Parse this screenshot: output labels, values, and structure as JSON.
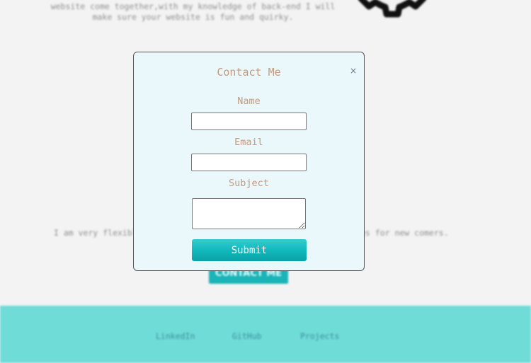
{
  "background": {
    "intro_line_1": "website come together,with my knowledge of back-end I will",
    "intro_line_2": "make sure your website is fun and quirky.",
    "flex_text_left": "I am very flexible",
    "flex_text_right": "es for new comers.",
    "contact_button_label": "CONTACT ME",
    "gear_icon": "gear-icon"
  },
  "footer": {
    "links": [
      "LinkedIn",
      "GitHub",
      "Projects"
    ],
    "background_color": "#6fdcd8",
    "link_color": "#3c8c97"
  },
  "modal": {
    "title": "Contact Me",
    "close_symbol": "×",
    "name_label": "Name",
    "name_value": "",
    "email_label": "Email",
    "email_value": "",
    "subject_label": "Subject",
    "subject_value": "",
    "submit_label": "Submit",
    "accent_color": "#19b3b8",
    "label_color": "#c39b7e"
  }
}
